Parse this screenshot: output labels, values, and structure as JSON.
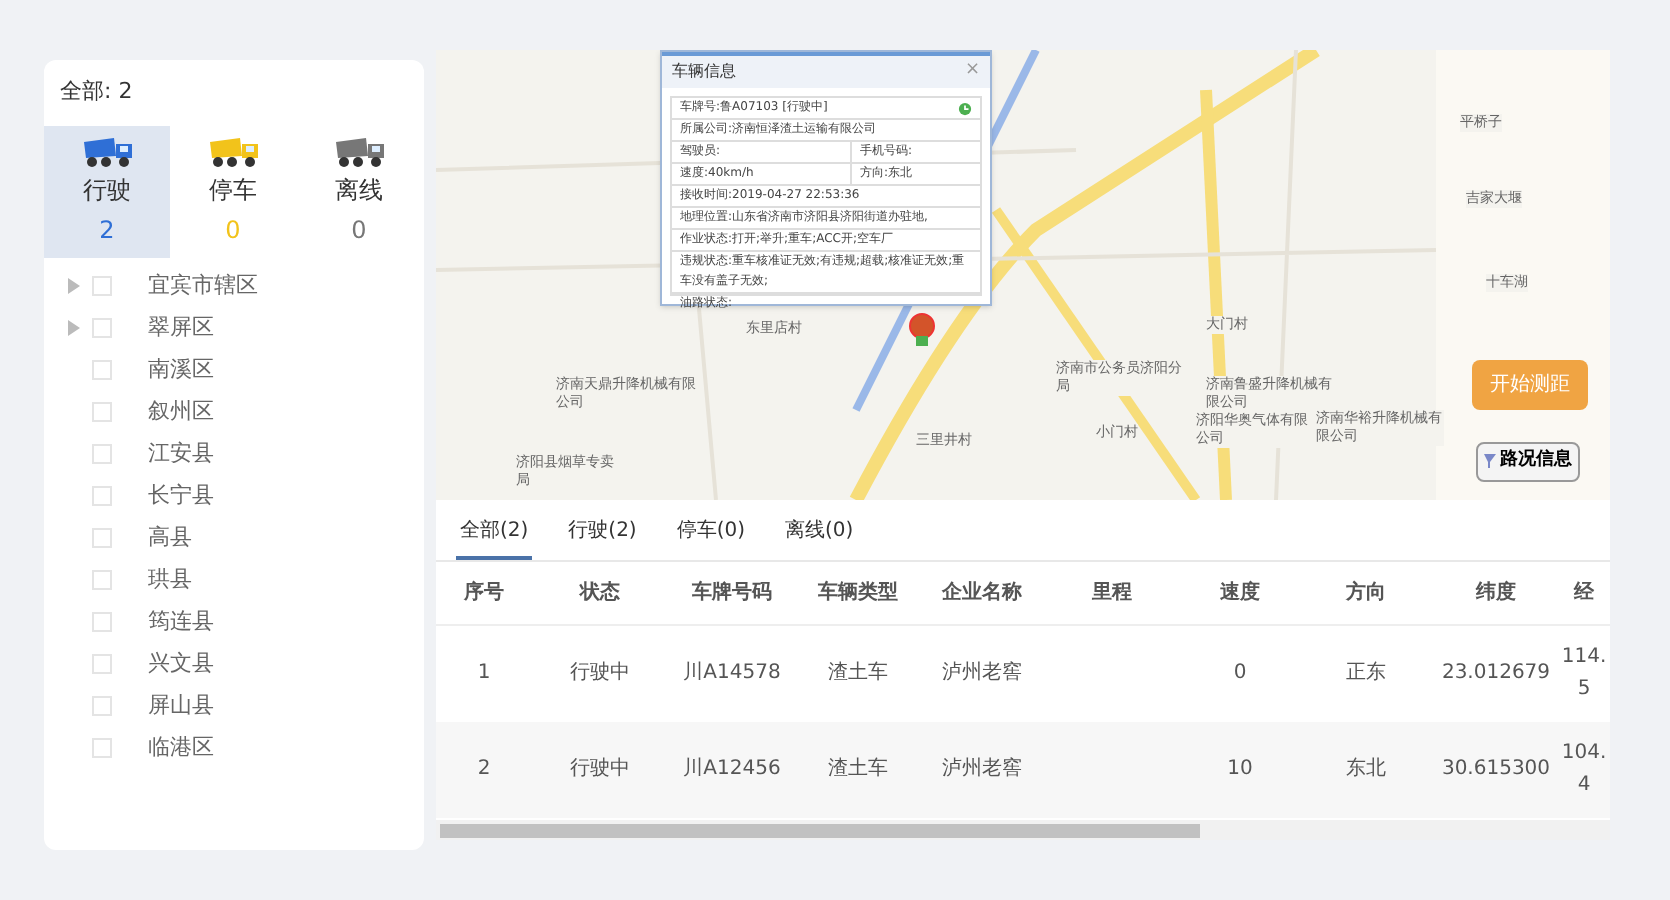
{
  "summary": {
    "label": "全部: 2"
  },
  "status_filters": [
    {
      "label": "行驶",
      "count": "2",
      "color": "#2f6fd6",
      "selected": true
    },
    {
      "label": "停车",
      "count": "0",
      "color": "#f2c31b",
      "selected": false
    },
    {
      "label": "离线",
      "count": "0",
      "color": "#777777",
      "selected": false
    }
  ],
  "region_tree": [
    {
      "label": "宜宾市辖区",
      "expandable": true,
      "checked": false
    },
    {
      "label": "翠屏区",
      "expandable": true,
      "checked": false
    },
    {
      "label": "南溪区",
      "expandable": false,
      "checked": false
    },
    {
      "label": "叙州区",
      "expandable": false,
      "checked": false
    },
    {
      "label": "江安县",
      "expandable": false,
      "checked": false
    },
    {
      "label": "长宁县",
      "expandable": false,
      "checked": false
    },
    {
      "label": "高县",
      "expandable": false,
      "checked": false
    },
    {
      "label": "珙县",
      "expandable": false,
      "checked": false
    },
    {
      "label": "筠连县",
      "expandable": false,
      "checked": false
    },
    {
      "label": "兴文县",
      "expandable": false,
      "checked": false
    },
    {
      "label": "屏山县",
      "expandable": false,
      "checked": false
    },
    {
      "label": "临港区",
      "expandable": false,
      "checked": false
    }
  ],
  "map": {
    "labels": [
      "东里店村",
      "济南天鼎升降机械有限公司",
      "济阳县烟草专卖局",
      "三里井村",
      "济南市公务员济阳分局",
      "大门村",
      "小门村",
      "济南鲁盛升降机械有限公司",
      "济阳华奥气体有限公司",
      "济南华裕升降机械有限公司",
      "平桥子",
      "吉家大堰",
      "十车湖"
    ],
    "popup": {
      "title": "车辆信息",
      "close": "×",
      "lines": [
        {
          "kind": "full",
          "text": "车牌号:鲁A07103 [行驶中]"
        },
        {
          "kind": "full",
          "text": "所属公司:济南恒泽渣土运输有限公司"
        },
        {
          "kind": "pair",
          "text": "驾驶员:",
          "text2": "手机号码:"
        },
        {
          "kind": "pair",
          "text": "速度:40km/h",
          "text2": "方向:东北"
        },
        {
          "kind": "full",
          "text": "接收时间:2019-04-27 22:53:36"
        },
        {
          "kind": "full",
          "text": "地理位置:山东省济南市济阳县济阳街道办驻地,"
        },
        {
          "kind": "full",
          "text": "作业状态:打开;举升;重车;ACC开;空车厂"
        },
        {
          "kind": "full",
          "text": "违规状态:重车核准证无效;有违规;超载;核准证无效;重车没有盖子无效;"
        }
      ]
    },
    "popup_below": "油路状态:",
    "measure_button": "开始测距",
    "traffic_button": "路况信息"
  },
  "tabs": [
    {
      "label": "全部(2)",
      "selected": true
    },
    {
      "label": "行驶(2)",
      "selected": false
    },
    {
      "label": "停车(0)",
      "selected": false
    },
    {
      "label": "离线(0)",
      "selected": false
    }
  ],
  "table": {
    "columns": [
      "序号",
      "状态",
      "车牌号码",
      "车辆类型",
      "企业名称",
      "里程",
      "速度",
      "方向",
      "纬度",
      "经"
    ],
    "rows": [
      [
        "1",
        "行驶中",
        "川A14578",
        "渣土车",
        "泸州老窖",
        "",
        "0",
        "正东",
        "23.012679",
        "114.5"
      ],
      [
        "2",
        "行驶中",
        "川A12456",
        "渣土车",
        "泸州老窖",
        "",
        "10",
        "东北",
        "30.615300",
        "104.4"
      ]
    ]
  }
}
